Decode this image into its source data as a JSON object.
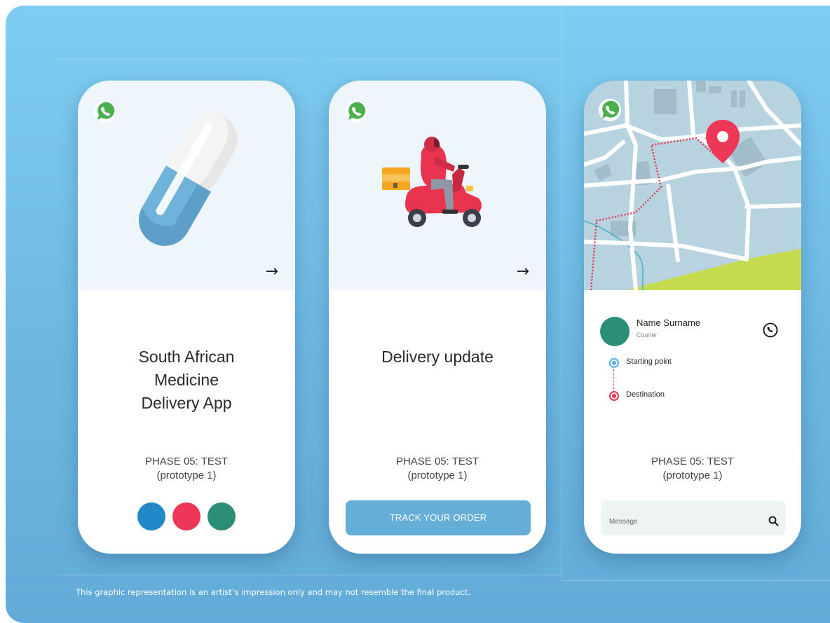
{
  "colors": {
    "blue": "#2288c8",
    "red": "#ee3756",
    "green": "#2a8f76",
    "button": "#64aed8",
    "hero_bg": "#eef6fc"
  },
  "screens": [
    {
      "title_lines": [
        "South African",
        "Medicine",
        "Delivery App"
      ],
      "phase": "PHASE 05: TEST",
      "phase_sub": "(prototype 1)",
      "icon": "pill-capsule-icon"
    },
    {
      "title_lines": [
        "Delivery update"
      ],
      "phase": "PHASE 05: TEST",
      "phase_sub": "(prototype 1)",
      "button_label": "TRACK YOUR ORDER",
      "icon": "delivery-scooter-icon"
    },
    {
      "courier": {
        "name": "Name Surname",
        "role": "Courier"
      },
      "route": {
        "start": "Starting point",
        "end": "Destination"
      },
      "phase": "PHASE 05: TEST",
      "phase_sub": "(prototype 1)",
      "message_placeholder": "Message"
    }
  ],
  "arrow_glyph": "→",
  "disclaimer": "This graphic representation is an artist’s impression only and may not resemble the final product."
}
